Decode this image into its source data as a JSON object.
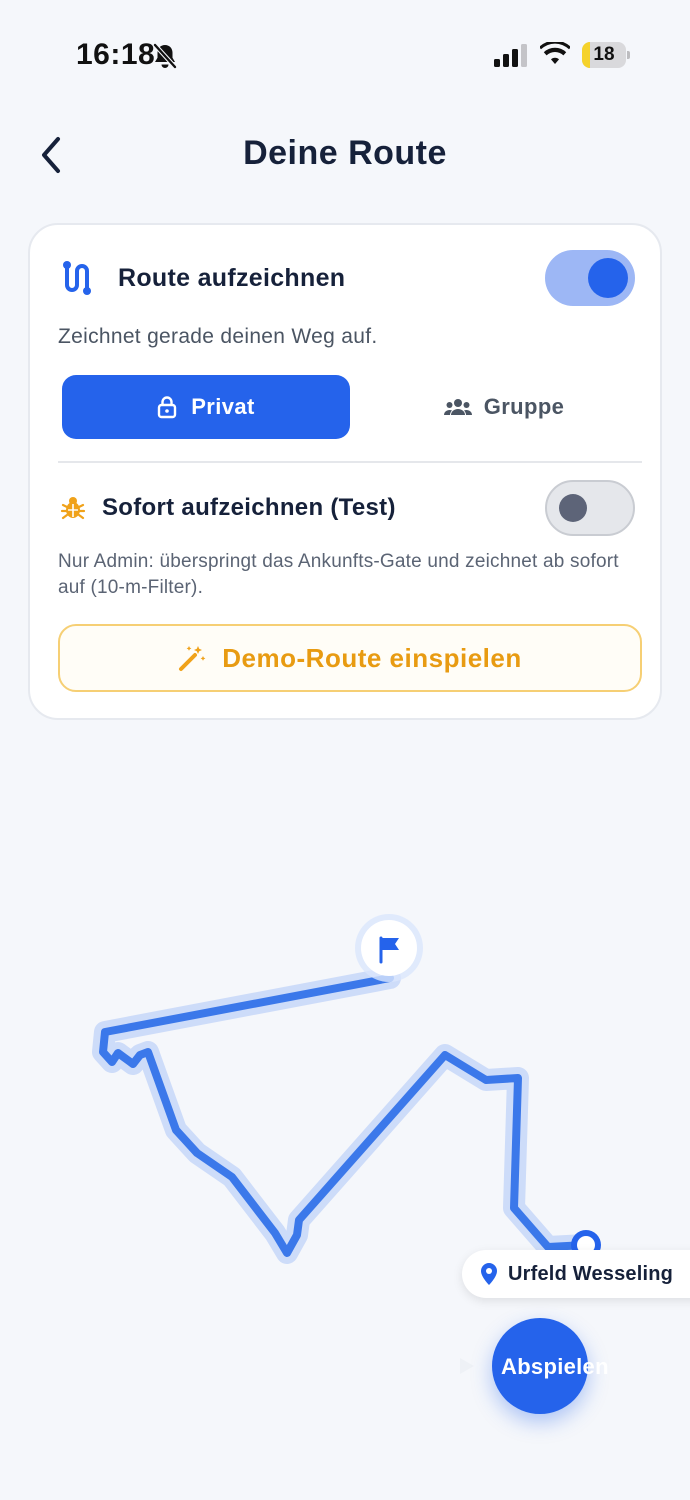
{
  "status_bar": {
    "time": "16:18",
    "battery_percent": "18",
    "battery_level": 0.18,
    "mute_icon": "bell-slash-icon",
    "signal_icon": "cellular-signal-icon",
    "wifi_icon": "wifi-icon"
  },
  "header": {
    "title": "Deine Route",
    "back_icon": "chevron-left-icon"
  },
  "recording_card": {
    "title": "Route aufzeichnen",
    "title_icon": "route-icon",
    "toggle_on": true,
    "subtitle": "Zeichnet gerade deinen Weg auf.",
    "segments": [
      {
        "label": "Privat",
        "icon": "lock-icon",
        "selected": true
      },
      {
        "label": "Gruppe",
        "icon": "group-icon",
        "selected": false
      }
    ],
    "instant_title": "Sofort aufzeichnen (Test)",
    "instant_icon": "bug-icon",
    "instant_toggle_on": false,
    "admin_note": "Nur Admin: überspringt das Ankunfts-Gate und zeichnet ab sofort auf (10-m-Filter).",
    "demo_button_label": "Demo-Route einspielen",
    "demo_button_icon": "magic-wand-icon"
  },
  "map": {
    "route_color": "#2563eb",
    "end_marker_icon": "flag-icon",
    "location_label": "Urfeld Wesseling",
    "location_icon": "map-pin-icon"
  },
  "play_button": {
    "label": "Abspielen",
    "icon": "play-icon"
  },
  "colors": {
    "accent": "#2563eb",
    "warning": "#e89b12",
    "background": "#f5f7fb"
  }
}
